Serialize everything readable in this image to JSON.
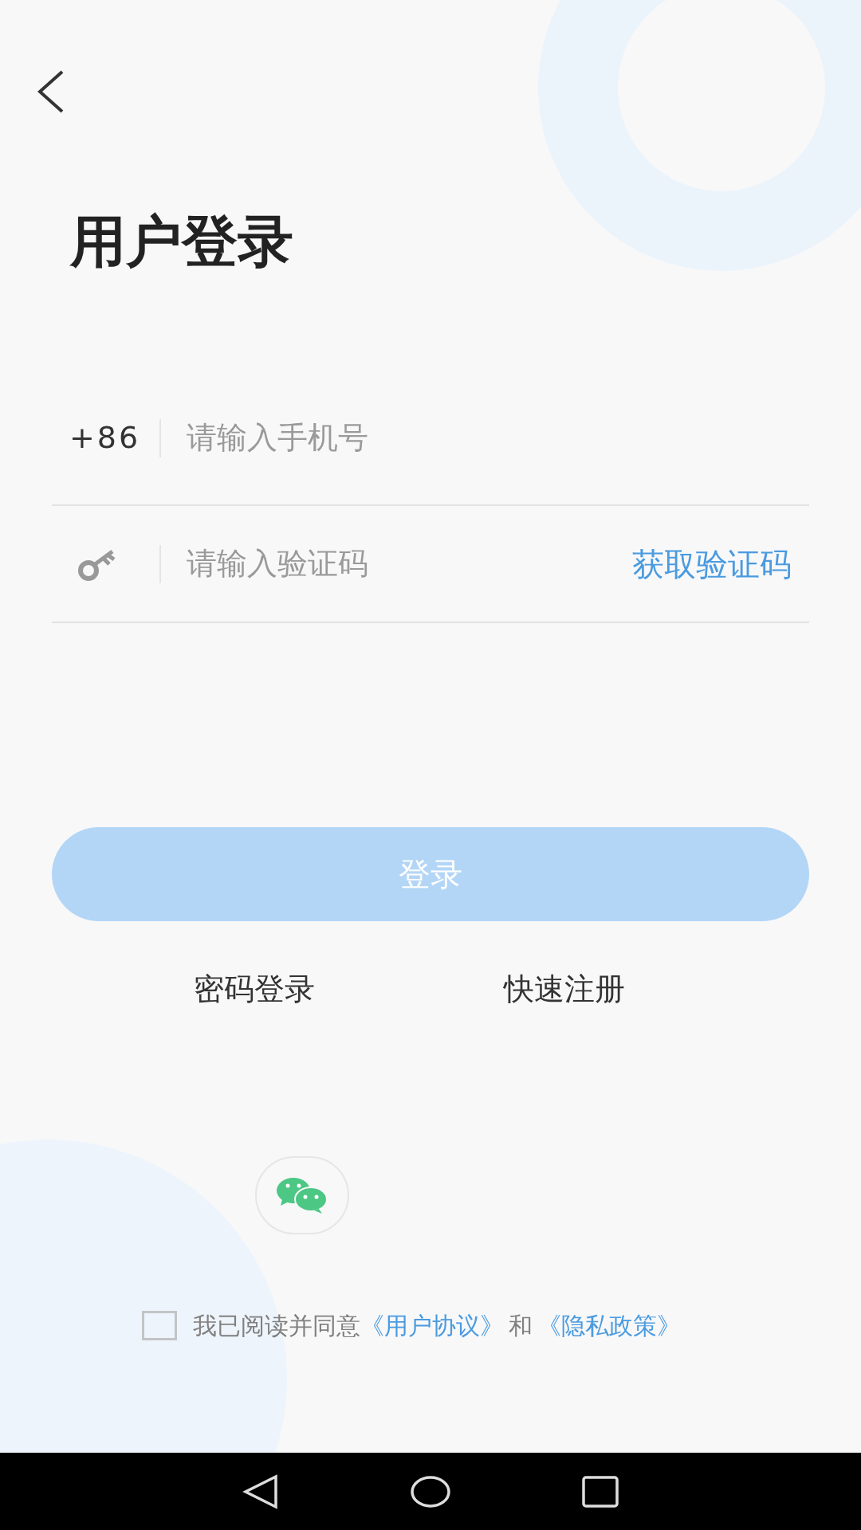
{
  "title": "用户登录",
  "phone_field": {
    "prefix": "+86",
    "placeholder": "请输入手机号"
  },
  "code_field": {
    "placeholder": "请输入验证码",
    "action": "获取验证码"
  },
  "login_button": {
    "label": "登录",
    "disabled": true
  },
  "links": [
    "密码登录",
    "快速注册"
  ],
  "agreement": {
    "checked": false,
    "text": "我已阅读并同意",
    "terms_link": "《用户协议》",
    "conjunction": "和",
    "privacy_link": "《隐私政策》"
  }
}
